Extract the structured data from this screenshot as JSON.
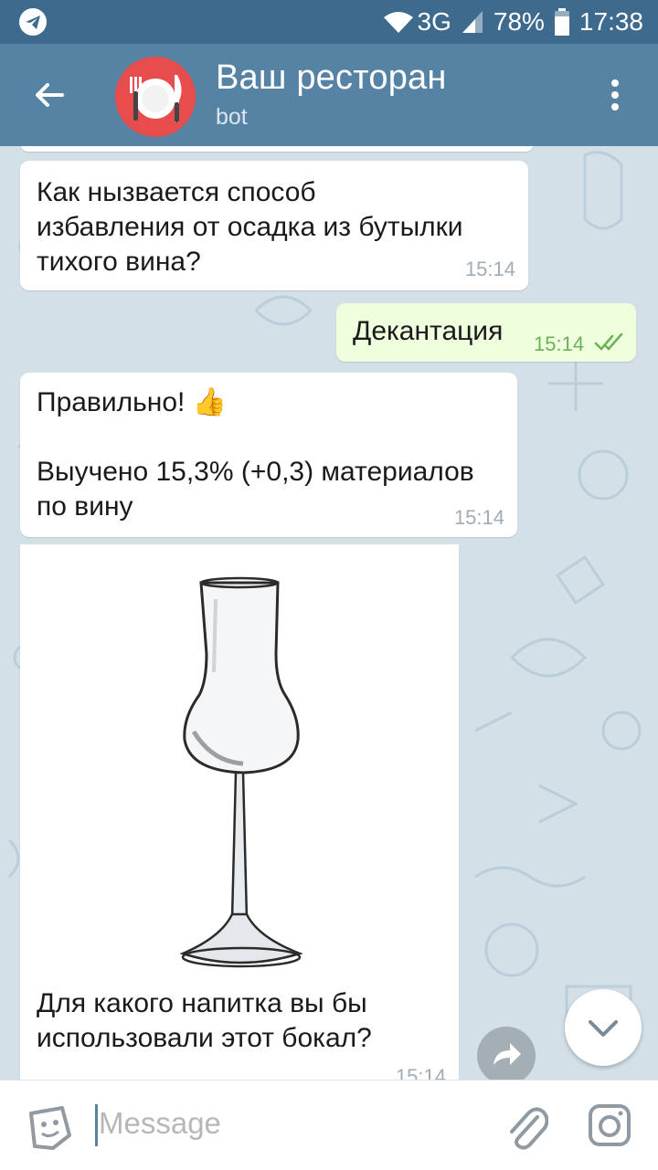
{
  "status_bar": {
    "network": "3G",
    "battery": "78%",
    "time": "17:38"
  },
  "header": {
    "title": "Ваш ресторан",
    "subtitle": "bot"
  },
  "messages": [
    {
      "text": "Как нызвается способ\nизбавления от осадка из бутылки\nтихого вина?",
      "time": "15:14",
      "direction": "in"
    },
    {
      "text": "Декантация",
      "time": "15:14",
      "direction": "out",
      "status": "read"
    },
    {
      "text": "Правильно! 👍\n\nВыучено 15,3% (+0,3) материалов\nпо вину",
      "time": "15:14",
      "direction": "in"
    },
    {
      "text": "Для какого напитка вы бы\nиспользовали этот бокал?",
      "time": "15:14",
      "direction": "in",
      "image": "grappa-glass"
    }
  ],
  "input": {
    "placeholder": "Message"
  },
  "icons": {
    "telegram": "telegram-icon",
    "back": "back-arrow-icon",
    "more": "more-vertical-icon",
    "emoji": "emoji-sticker-icon",
    "attach": "paperclip-icon",
    "camera": "camera-icon",
    "scroll_down": "chevron-down-icon",
    "share": "share-icon"
  },
  "colors": {
    "header": "#5682a3",
    "status_bar": "#3e6a8e",
    "outgoing_bubble": "#efffde",
    "chat_bg": "#d3e0e8"
  }
}
